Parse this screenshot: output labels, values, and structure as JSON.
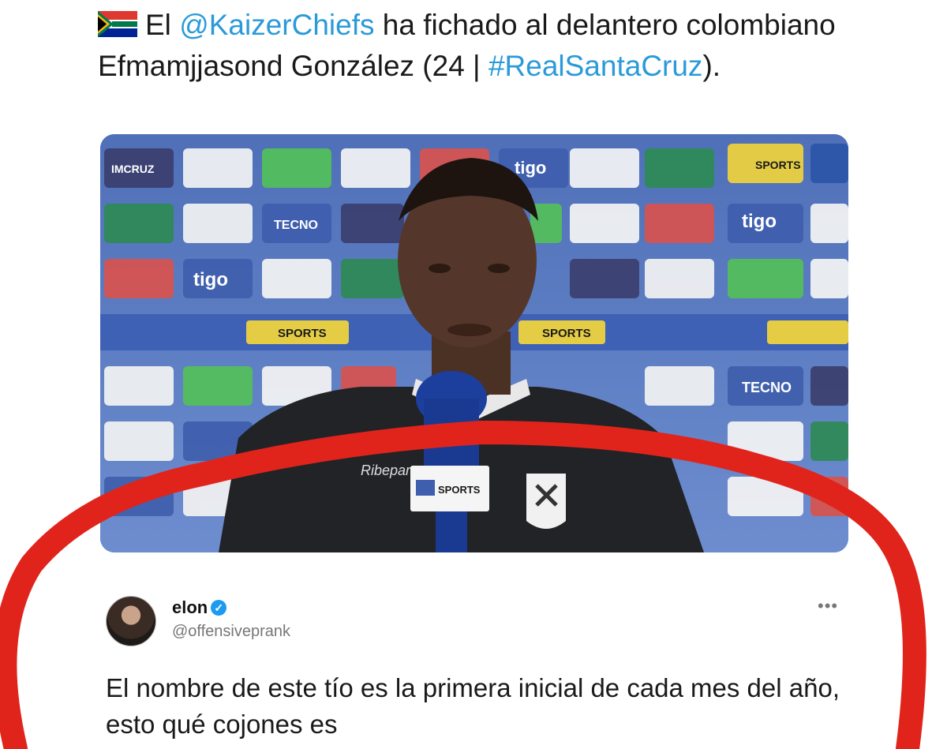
{
  "tweet": {
    "text_prefix": "El ",
    "mention": "@KaizerChiefs",
    "text_middle": " ha fichado al delantero colombiano Efmamjjasond González (24 | ",
    "hashtag": "#RealSantaCruz",
    "text_suffix": ").",
    "flag_icon": "south-africa-flag-icon"
  },
  "media": {
    "backdrop_sponsors": [
      "IMCRUZ",
      "tigo",
      "TECNO",
      "SPORTS"
    ],
    "mic_label": "SPORTS",
    "jersey_sponsor": "Ribepar"
  },
  "reply": {
    "name": "elon",
    "handle": "@offensiveprank",
    "text": "El nombre de este tío es la primera inicial de cada mes del año, esto qué cojones es",
    "more_icon": "more-dots-icon",
    "verified_icon": "verified-badge-icon"
  },
  "colors": {
    "link": "#2b9ad9",
    "annotation": "#e0241b"
  }
}
